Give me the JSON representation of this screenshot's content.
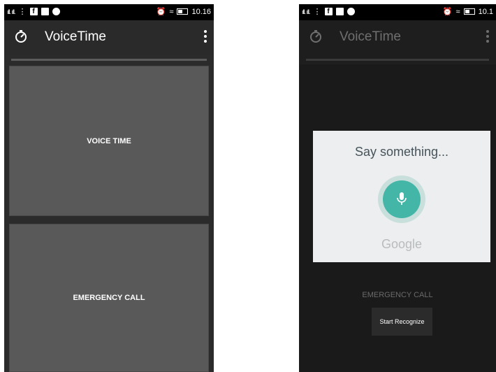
{
  "left": {
    "status": {
      "signal": "ıll. ıll.",
      "time": "10.16"
    },
    "app": {
      "title": "VoiceTime"
    },
    "buttons": {
      "voice_time": "VOICE TIME",
      "emergency_call": "EMERGENCY CALL"
    }
  },
  "right": {
    "status": {
      "signal": "ıll. ıll.",
      "time": "10.1"
    },
    "app": {
      "title": "VoiceTime"
    },
    "emergency_label": "EMERGENCY CALL",
    "recognize_button": "Start Recognize",
    "dialog": {
      "prompt": "Say something...",
      "brand": "Google"
    }
  },
  "colors": {
    "accent": "#43b6a7",
    "button_bg": "#595959",
    "dialog_bg": "#eceeef"
  }
}
